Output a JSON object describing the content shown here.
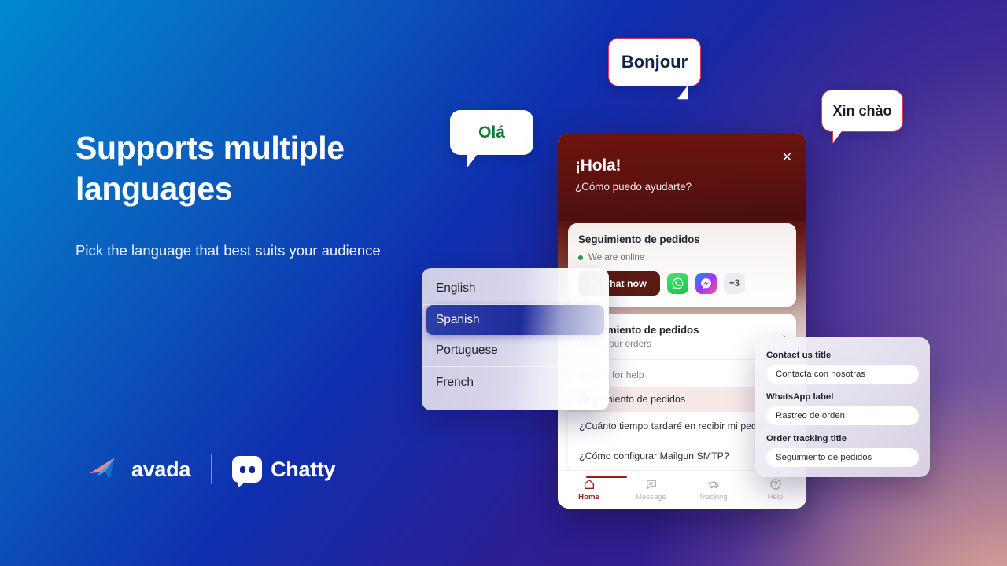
{
  "hero": {
    "headline": "Supports multiple languages",
    "subcopy": "Pick the language that best suits your audience"
  },
  "brand": {
    "avada_name": "avada",
    "chatty_name": "Chatty"
  },
  "bubbles": [
    {
      "text": "Olá",
      "lang": "portuguese"
    },
    {
      "text": "Bonjour",
      "lang": "french"
    },
    {
      "text": "Xin chào",
      "lang": "vietnamese"
    }
  ],
  "language_menu": {
    "items": [
      {
        "label": "English",
        "selected": false
      },
      {
        "label": "Spanish",
        "selected": true
      },
      {
        "label": "Portuguese",
        "selected": false
      },
      {
        "label": "French",
        "selected": false
      }
    ]
  },
  "widget": {
    "close_label": "✕",
    "greeting": "¡Hola!",
    "greeting_sub": "¿Cómo puedo ayudarte?",
    "contact_card": {
      "title": "Seguimiento de pedidos",
      "status": "We are online",
      "chat_now": "Chat now",
      "more_channels": "+3"
    },
    "tracking_card": {
      "title": "Seguimiento de pedidos",
      "subtitle": "Track your orders",
      "chevron": "›"
    },
    "faq": {
      "heading": "Search for help",
      "highlight": "Seguimiento de pedidos",
      "items": [
        "¿Cuánto tiempo tardaré en recibir mi pedido?",
        "¿Cómo configurar Mailgun SMTP?"
      ]
    },
    "nav": [
      {
        "label": "Home",
        "active": true
      },
      {
        "label": "Message",
        "active": false
      },
      {
        "label": "Tracking",
        "active": false
      },
      {
        "label": "Help",
        "active": false
      }
    ]
  },
  "settings_panel": {
    "fields": [
      {
        "label": "Contact us title",
        "value": "Contacta con nosotras"
      },
      {
        "label": "WhatsApp label",
        "value": "Rastreo de orden"
      },
      {
        "label": "Order tracking title",
        "value": "Seguimiento de pedidos"
      }
    ]
  },
  "colors": {
    "accent_blue": "#1e2a9b",
    "widget_header": "#5d120f",
    "nav_active": "#9e1b17",
    "online_green": "#1f9b4b",
    "bubble_border": "#e0365a"
  }
}
